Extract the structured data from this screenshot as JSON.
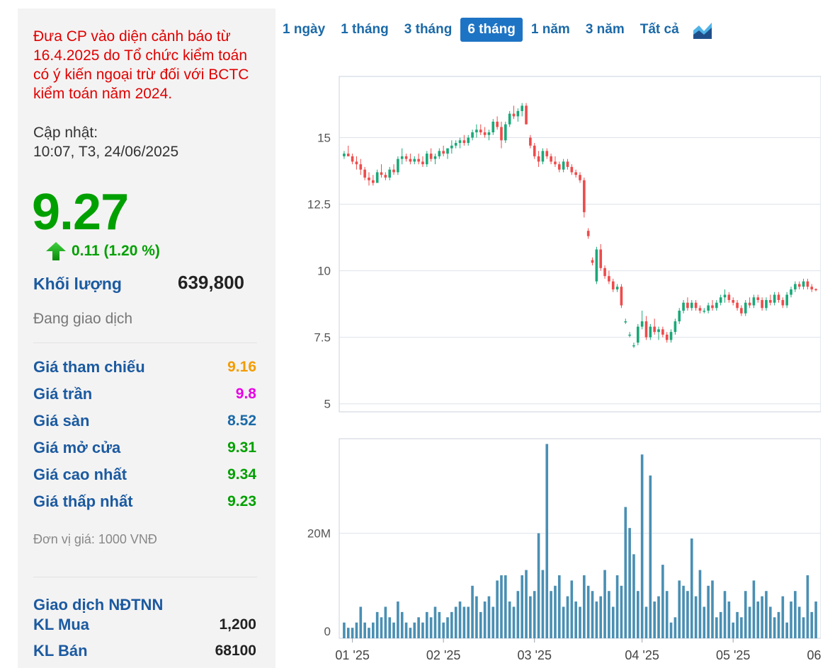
{
  "stock": {
    "warning": "Đưa CP vào diện cảnh báo từ 16.4.2025 do Tổ chức kiểm toán có ý kiến ngoại trừ đối với BCTC kiểm toán năm 2024.",
    "update_label": "Cập nhật:",
    "update_time": "10:07, T3, 24/06/2025",
    "price": "9.27",
    "change": "0.11 (1.20 %)",
    "volume_label": "Khối lượng",
    "volume_value": "639,800",
    "status": "Đang giao dịch",
    "stats": [
      {
        "label": "Giá tham chiếu",
        "value": "9.16",
        "color": "#f39c00"
      },
      {
        "label": "Giá trần",
        "value": "9.8",
        "color": "#e600e6"
      },
      {
        "label": "Giá sàn",
        "value": "8.52",
        "color": "#1b6aa8"
      },
      {
        "label": "Giá mở cửa",
        "value": "9.31",
        "color": "#00a000"
      },
      {
        "label": "Giá cao nhất",
        "value": "9.34",
        "color": "#00a000"
      },
      {
        "label": "Giá thấp nhất",
        "value": "9.23",
        "color": "#00a000"
      }
    ],
    "unit_note": "Đơn vị giá: 1000 VNĐ",
    "foreign_title": "Giao dịch NĐTNN",
    "foreign": [
      {
        "label": "KL Mua",
        "value": "1,200"
      },
      {
        "label": "KL Bán",
        "value": "68100"
      }
    ]
  },
  "tabs": [
    {
      "label": "1 ngày",
      "active": false
    },
    {
      "label": "1 tháng",
      "active": false
    },
    {
      "label": "3 tháng",
      "active": false
    },
    {
      "label": "6 tháng",
      "active": true
    },
    {
      "label": "1 năm",
      "active": false
    },
    {
      "label": "3 năm",
      "active": false
    },
    {
      "label": "Tất cả",
      "active": false
    }
  ],
  "colors": {
    "up": "#1aa879",
    "down": "#ee4b4b",
    "volume": "#4a8fb3",
    "grid": "#dde3ea"
  },
  "chart_data": {
    "type": "candlestick",
    "price_axis": {
      "ticks": [
        "5",
        "7.5",
        "10",
        "12.5",
        "15"
      ],
      "range": [
        4.7,
        17.3
      ]
    },
    "volume_axis": {
      "ticks": [
        "0",
        "20M"
      ],
      "range": [
        0,
        38
      ]
    },
    "x_labels": [
      "01 '25",
      "02 '25",
      "03 '25",
      "04 '25",
      "05 '25",
      "06 '25"
    ],
    "x_label_index": [
      2,
      24,
      46,
      72,
      94,
      116
    ],
    "ohlc": [
      [
        14.3,
        14.5,
        14.2,
        14.4
      ],
      [
        14.4,
        14.7,
        14.3,
        14.3
      ],
      [
        14.3,
        14.4,
        14.0,
        14.1
      ],
      [
        14.1,
        14.3,
        13.8,
        14.0
      ],
      [
        14.0,
        14.2,
        13.6,
        13.8
      ],
      [
        13.8,
        13.9,
        13.4,
        13.5
      ],
      [
        13.5,
        13.7,
        13.2,
        13.4
      ],
      [
        13.4,
        13.6,
        13.2,
        13.3
      ],
      [
        13.3,
        13.8,
        13.3,
        13.7
      ],
      [
        13.7,
        14.0,
        13.5,
        13.6
      ],
      [
        13.6,
        13.7,
        13.4,
        13.5
      ],
      [
        13.5,
        13.9,
        13.4,
        13.8
      ],
      [
        13.8,
        14.0,
        13.6,
        13.7
      ],
      [
        13.7,
        14.3,
        13.6,
        14.2
      ],
      [
        14.2,
        14.6,
        14.0,
        14.3
      ],
      [
        14.3,
        14.4,
        14.1,
        14.2
      ],
      [
        14.2,
        14.4,
        14.0,
        14.1
      ],
      [
        14.1,
        14.3,
        14.0,
        14.2
      ],
      [
        14.2,
        14.4,
        14.0,
        14.1
      ],
      [
        14.1,
        14.3,
        13.9,
        14.0
      ],
      [
        14.0,
        14.5,
        13.9,
        14.4
      ],
      [
        14.4,
        14.6,
        14.1,
        14.2
      ],
      [
        14.2,
        14.4,
        14.0,
        14.3
      ],
      [
        14.3,
        14.6,
        14.2,
        14.5
      ],
      [
        14.5,
        14.7,
        14.3,
        14.4
      ],
      [
        14.4,
        14.6,
        14.2,
        14.6
      ],
      [
        14.6,
        14.9,
        14.4,
        14.7
      ],
      [
        14.7,
        14.9,
        14.6,
        14.8
      ],
      [
        14.8,
        15.0,
        14.6,
        14.9
      ],
      [
        14.9,
        15.1,
        14.7,
        14.8
      ],
      [
        14.8,
        15.1,
        14.7,
        15.0
      ],
      [
        15.0,
        15.3,
        14.9,
        15.2
      ],
      [
        15.2,
        15.5,
        15.0,
        15.3
      ],
      [
        15.3,
        15.5,
        15.1,
        15.2
      ],
      [
        15.2,
        15.4,
        15.0,
        15.1
      ],
      [
        15.1,
        15.3,
        14.9,
        15.2
      ],
      [
        15.2,
        15.7,
        15.1,
        15.6
      ],
      [
        15.6,
        15.8,
        15.3,
        15.4
      ],
      [
        15.4,
        15.6,
        14.6,
        14.9
      ],
      [
        14.9,
        15.6,
        14.8,
        15.5
      ],
      [
        15.5,
        16.0,
        15.4,
        15.9
      ],
      [
        15.9,
        16.2,
        15.7,
        15.8
      ],
      [
        15.8,
        16.1,
        15.6,
        16.0
      ],
      [
        16.0,
        16.3,
        15.8,
        16.2
      ],
      [
        16.2,
        16.3,
        15.5,
        15.5
      ],
      [
        15.0,
        15.1,
        14.6,
        14.7
      ],
      [
        14.7,
        14.8,
        14.2,
        14.3
      ],
      [
        14.3,
        14.5,
        13.9,
        14.1
      ],
      [
        14.1,
        14.6,
        14.0,
        14.5
      ],
      [
        14.5,
        14.6,
        14.2,
        14.3
      ],
      [
        14.3,
        14.4,
        14.0,
        14.1
      ],
      [
        14.1,
        14.3,
        13.9,
        14.0
      ],
      [
        14.0,
        14.1,
        13.7,
        13.8
      ],
      [
        13.8,
        14.2,
        13.7,
        14.1
      ],
      [
        14.1,
        14.2,
        13.8,
        13.9
      ],
      [
        13.9,
        14.0,
        13.6,
        13.7
      ],
      [
        13.7,
        13.8,
        13.5,
        13.6
      ],
      [
        13.6,
        13.7,
        13.3,
        13.4
      ],
      [
        13.4,
        13.5,
        12.0,
        12.2
      ],
      [
        11.5,
        11.6,
        11.2,
        11.3
      ],
      [
        10.4,
        10.5,
        10.2,
        10.3
      ],
      [
        9.6,
        10.9,
        9.5,
        10.8
      ],
      [
        10.8,
        11.0,
        10.0,
        10.1
      ],
      [
        10.1,
        10.2,
        9.7,
        9.8
      ],
      [
        9.8,
        10.0,
        9.5,
        9.6
      ],
      [
        9.6,
        9.7,
        9.2,
        9.3
      ],
      [
        9.3,
        9.5,
        9.2,
        9.4
      ],
      [
        9.4,
        9.5,
        8.6,
        8.7
      ],
      [
        8.1,
        8.2,
        8.0,
        8.1
      ],
      [
        7.6,
        7.7,
        7.5,
        7.6
      ],
      [
        7.2,
        7.3,
        7.1,
        7.2
      ],
      [
        7.3,
        8.0,
        7.2,
        7.9
      ],
      [
        7.9,
        8.5,
        7.8,
        8.1
      ],
      [
        8.1,
        8.3,
        7.4,
        7.5
      ],
      [
        7.5,
        8.0,
        7.4,
        7.9
      ],
      [
        7.9,
        8.2,
        7.6,
        7.7
      ],
      [
        7.7,
        7.9,
        7.4,
        7.8
      ],
      [
        7.8,
        7.9,
        7.5,
        7.6
      ],
      [
        7.6,
        7.7,
        7.3,
        7.4
      ],
      [
        7.4,
        7.8,
        7.3,
        7.7
      ],
      [
        7.7,
        8.2,
        7.6,
        8.1
      ],
      [
        8.1,
        8.6,
        8.0,
        8.5
      ],
      [
        8.5,
        8.9,
        8.4,
        8.8
      ],
      [
        8.8,
        9.0,
        8.5,
        8.6
      ],
      [
        8.6,
        8.9,
        8.5,
        8.8
      ],
      [
        8.8,
        8.9,
        8.5,
        8.6
      ],
      [
        8.6,
        8.7,
        8.4,
        8.5
      ],
      [
        8.5,
        8.6,
        8.4,
        8.5
      ],
      [
        8.5,
        8.8,
        8.4,
        8.7
      ],
      [
        8.7,
        8.9,
        8.5,
        8.6
      ],
      [
        8.6,
        8.9,
        8.5,
        8.8
      ],
      [
        8.8,
        9.1,
        8.7,
        9.0
      ],
      [
        9.0,
        9.3,
        8.8,
        9.1
      ],
      [
        9.1,
        9.2,
        8.8,
        8.9
      ],
      [
        8.9,
        9.0,
        8.7,
        8.8
      ],
      [
        8.8,
        8.9,
        8.5,
        8.6
      ],
      [
        8.6,
        8.7,
        8.3,
        8.4
      ],
      [
        8.4,
        8.9,
        8.3,
        8.8
      ],
      [
        8.8,
        9.0,
        8.6,
        8.7
      ],
      [
        8.7,
        9.1,
        8.6,
        9.0
      ],
      [
        9.0,
        9.1,
        8.8,
        8.9
      ],
      [
        8.9,
        9.0,
        8.5,
        8.6
      ],
      [
        8.6,
        9.0,
        8.5,
        8.9
      ],
      [
        8.9,
        9.1,
        8.7,
        8.8
      ],
      [
        8.8,
        9.2,
        8.7,
        9.1
      ],
      [
        9.1,
        9.2,
        8.8,
        8.9
      ],
      [
        8.9,
        9.0,
        8.6,
        8.7
      ],
      [
        8.7,
        9.2,
        8.6,
        9.1
      ],
      [
        9.1,
        9.4,
        9.0,
        9.3
      ],
      [
        9.3,
        9.6,
        9.2,
        9.5
      ],
      [
        9.5,
        9.6,
        9.3,
        9.4
      ],
      [
        9.4,
        9.7,
        9.3,
        9.6
      ],
      [
        9.6,
        9.7,
        9.3,
        9.4
      ],
      [
        9.4,
        9.5,
        9.2,
        9.3
      ],
      [
        9.31,
        9.34,
        9.23,
        9.27
      ]
    ],
    "volume": [
      3,
      2,
      2,
      3,
      6,
      3,
      2,
      3,
      5,
      4,
      6,
      4,
      3,
      7,
      5,
      3,
      2,
      3,
      4,
      3,
      5,
      4,
      6,
      5,
      3,
      4,
      5,
      6,
      7,
      6,
      6,
      10,
      8,
      5,
      7,
      8,
      6,
      11,
      12,
      12,
      7,
      6,
      9,
      12,
      13,
      8,
      9,
      20,
      13,
      11,
      9,
      10,
      12,
      6,
      8,
      11,
      7,
      6,
      12,
      10,
      9,
      7,
      8,
      13,
      9,
      6,
      12,
      10,
      25,
      21,
      16,
      9,
      35,
      6,
      9,
      7,
      8,
      14,
      9,
      3,
      4,
      11,
      10,
      9,
      19,
      8,
      13,
      6,
      10,
      11,
      4,
      5,
      9,
      7,
      3,
      5,
      4,
      9,
      6,
      11,
      7,
      8,
      9,
      6,
      4,
      5,
      8,
      3,
      7,
      9,
      6,
      4,
      12,
      5,
      7,
      10,
      10,
      11,
      8,
      4,
      3,
      5
    ],
    "volume_spikes": {
      "49": 37,
      "74": 31
    }
  }
}
